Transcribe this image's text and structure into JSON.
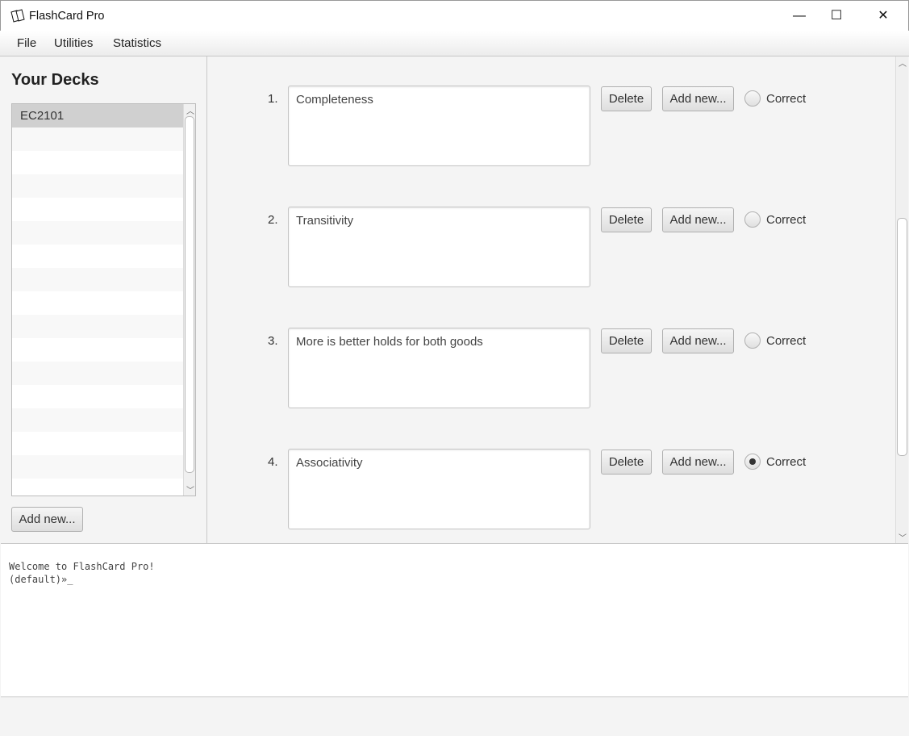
{
  "window": {
    "title": "FlashCard Pro",
    "icon": "cards-icon",
    "minimize": "—",
    "maximize": "☐",
    "close": "✕"
  },
  "menu": [
    "File",
    "Utilities",
    "Statistics"
  ],
  "decks": {
    "title": "Your Decks",
    "items": [
      "EC2101"
    ],
    "add_label": "Add new..."
  },
  "cards": [
    {
      "number": "1.",
      "text": "Completeness",
      "correct": false
    },
    {
      "number": "2.",
      "text": "Transitivity",
      "correct": false
    },
    {
      "number": "3.",
      "text": "More is better holds for both goods",
      "correct": false
    },
    {
      "number": "4.",
      "text": "Associativity",
      "correct": true
    }
  ],
  "card_buttons": {
    "delete": "Delete",
    "add": "Add new...",
    "correct": "Correct"
  },
  "console": {
    "lines": [
      "Welcome to FlashCard Pro!",
      "(default)»_"
    ]
  }
}
